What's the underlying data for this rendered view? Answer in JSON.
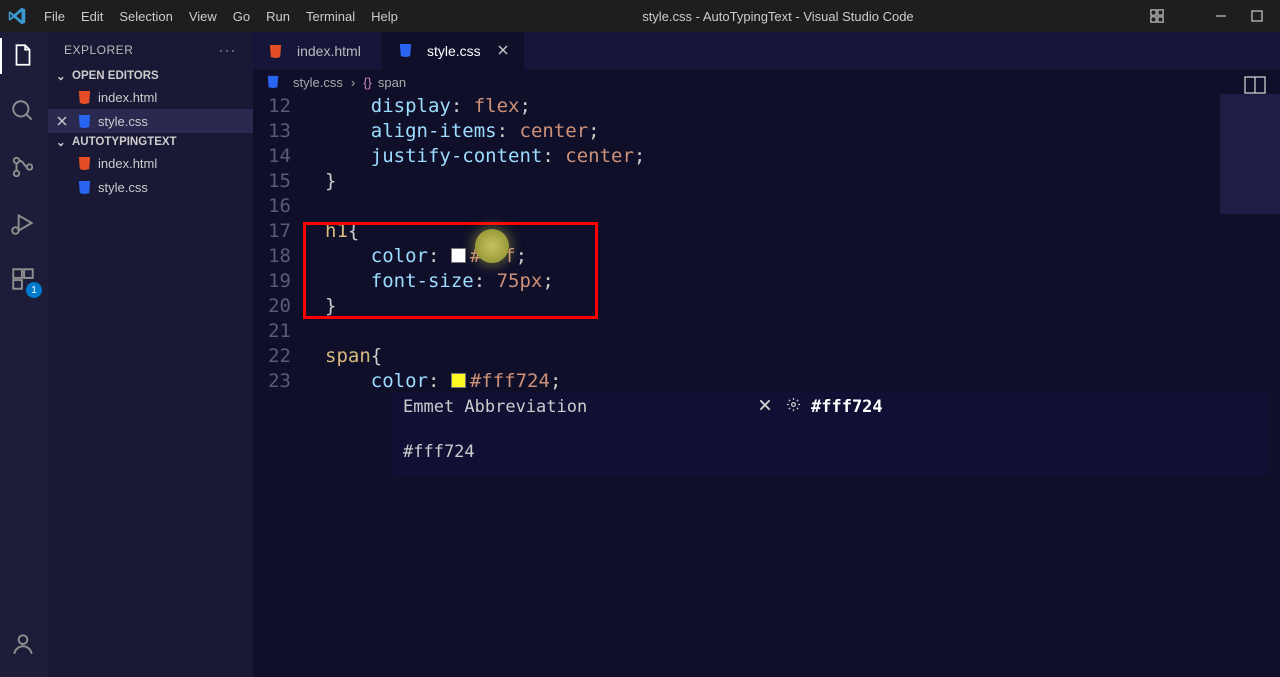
{
  "title_bar": {
    "file_name": "style.css",
    "project_name": "AutoTypingText",
    "app_name": "Visual Studio Code"
  },
  "menu": {
    "file": "File",
    "edit": "Edit",
    "selection": "Selection",
    "view": "View",
    "go": "Go",
    "run": "Run",
    "terminal": "Terminal",
    "help": "Help"
  },
  "sidebar": {
    "header": "EXPLORER",
    "open_editors_label": "OPEN EDITORS",
    "open_editors": {
      "items": [
        {
          "icon": "html-file-icon",
          "label": "index.html",
          "active": false
        },
        {
          "icon": "css-file-icon",
          "label": "style.css",
          "active": true
        }
      ]
    },
    "project_label": "AUTOTYPINGTEXT",
    "project_files": {
      "items": [
        {
          "icon": "html-file-icon",
          "label": "index.html"
        },
        {
          "icon": "css-file-icon",
          "label": "style.css"
        }
      ]
    }
  },
  "tabs": {
    "items": [
      {
        "icon": "html-file-icon",
        "label": "index.html",
        "active": false
      },
      {
        "icon": "css-file-icon",
        "label": "style.css",
        "active": true
      }
    ]
  },
  "breadcrumb": {
    "file_icon": "css-file-icon",
    "file": "style.css",
    "symbol_icon": "bracket-icon",
    "symbol": "span"
  },
  "code": {
    "lines": [
      {
        "n": "12",
        "indent": "    ",
        "prop": "display",
        "val": "flex",
        "tail": ";"
      },
      {
        "n": "13",
        "indent": "    ",
        "prop": "align-items",
        "val": "center",
        "tail": ";"
      },
      {
        "n": "14",
        "indent": "    ",
        "prop": "justify-content",
        "val": "center",
        "tail": ";"
      },
      {
        "n": "15",
        "raw": "}",
        "kind": "close"
      },
      {
        "n": "16",
        "raw": "",
        "kind": "blank"
      },
      {
        "n": "17",
        "tag": "h1",
        "kind": "open"
      },
      {
        "n": "18",
        "indent": "    ",
        "prop": "color",
        "swatch": "#ffffff",
        "val": "#fff",
        "tail": ";"
      },
      {
        "n": "19",
        "indent": "    ",
        "prop": "font-size",
        "val": "75px",
        "tail": ";"
      },
      {
        "n": "20",
        "raw": "}",
        "kind": "close"
      },
      {
        "n": "21",
        "raw": "",
        "kind": "blank"
      },
      {
        "n": "22",
        "tag": "span",
        "kind": "open"
      },
      {
        "n": "23",
        "indent": "    ",
        "prop": "color",
        "swatch": "#fff724",
        "val": "#fff724",
        "tail": ";"
      }
    ]
  },
  "overlay": {
    "title": "Emmet Abbreviation",
    "entry_text": "#fff724",
    "result": "#fff724"
  },
  "badge": {
    "count": "1"
  },
  "colors": {
    "red_box": "#ff0000",
    "swatch_white": "#ffffff",
    "swatch_yellow": "#fff724"
  }
}
